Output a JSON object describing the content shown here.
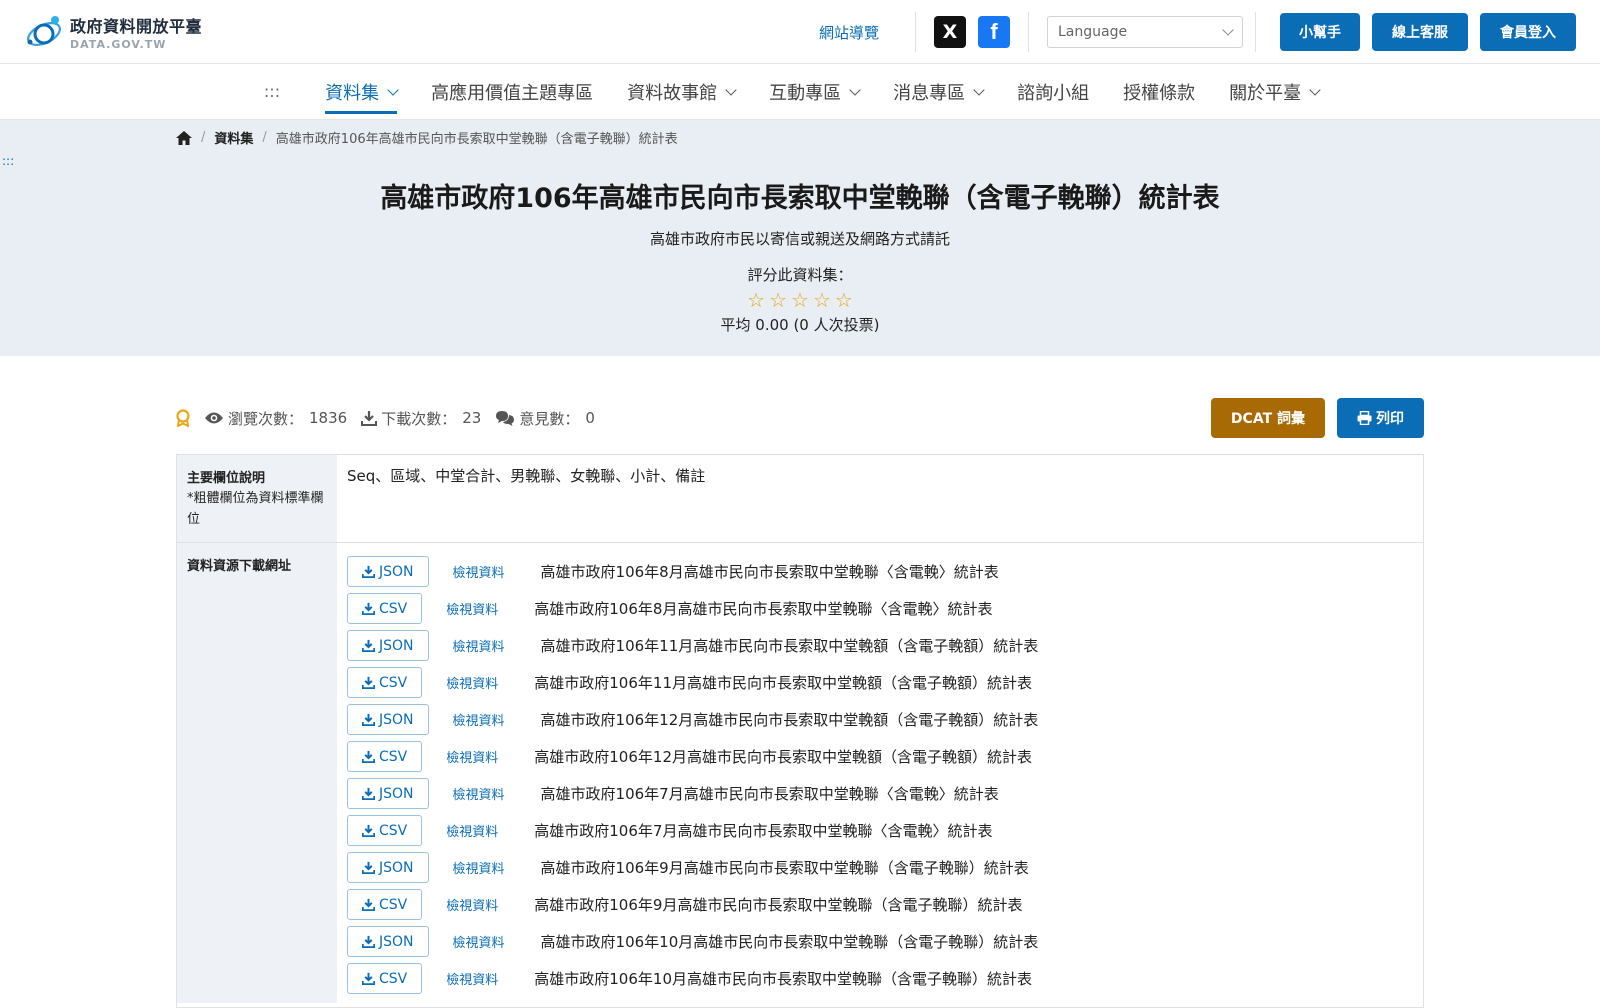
{
  "header": {
    "logo_title": "政府資料開放平臺",
    "logo_sub": "DATA.GOV.TW",
    "sitemap": "網站導覽",
    "social_x": "X",
    "social_fb": "f",
    "language_placeholder": "Language",
    "helper_btn": "小幫手",
    "service_btn": "線上客服",
    "login_btn": "會員登入"
  },
  "nav": {
    "access": ":::",
    "items": [
      {
        "label": "資料集"
      },
      {
        "label": "高應用價值主題專區"
      },
      {
        "label": "資料故事館"
      },
      {
        "label": "互動專區"
      },
      {
        "label": "消息專區"
      },
      {
        "label": "諮詢小組"
      },
      {
        "label": "授權條款"
      },
      {
        "label": "關於平臺"
      }
    ]
  },
  "breadcrumb": {
    "dataset": "資料集",
    "current": "高雄市政府106年高雄市民向市長索取中堂輓聯（含電子輓聯）統計表"
  },
  "hero": {
    "access": ":::",
    "title": "高雄市政府106年高雄市民向市長索取中堂輓聯（含電子輓聯）統計表",
    "desc": "高雄市政府市民以寄信或親送及網路方式請託",
    "rate_label": "評分此資料集：",
    "rating": 0,
    "avg": "平均 0.00 (0 人次投票)"
  },
  "stats": {
    "views_label": "瀏覽次數：",
    "views": "1836",
    "downloads_label": "下載次數：",
    "downloads": "23",
    "comments_label": "意見數：",
    "comments": "0",
    "dcat_btn": "DCAT 詞彙",
    "print_btn": "列印"
  },
  "table": {
    "fields_header": "主要欄位說明",
    "fields_sub": "*粗體欄位為資料標準欄位",
    "fields_value": "Seq、區域、中堂合計、男輓聯、女輓聯、小計、備註",
    "resources_header": "資料資源下載網址",
    "view_label": "檢視資料",
    "resources": [
      {
        "format": "JSON",
        "name": "高雄市政府106年8月高雄市民向市長索取中堂輓聯〈含電輓〉統計表"
      },
      {
        "format": "CSV",
        "name": "高雄市政府106年8月高雄市民向市長索取中堂輓聯〈含電輓〉統計表"
      },
      {
        "format": "JSON",
        "name": "高雄市政府106年11月高雄市民向市長索取中堂輓額（含電子輓額）統計表"
      },
      {
        "format": "CSV",
        "name": "高雄市政府106年11月高雄市民向市長索取中堂輓額（含電子輓額）統計表"
      },
      {
        "format": "JSON",
        "name": "高雄市政府106年12月高雄市民向市長索取中堂輓額（含電子輓額）統計表"
      },
      {
        "format": "CSV",
        "name": "高雄市政府106年12月高雄市民向市長索取中堂輓額（含電子輓額）統計表"
      },
      {
        "format": "JSON",
        "name": "高雄市政府106年7月高雄市民向市長索取中堂輓聯〈含電輓〉統計表"
      },
      {
        "format": "CSV",
        "name": "高雄市政府106年7月高雄市民向市長索取中堂輓聯〈含電輓〉統計表"
      },
      {
        "format": "JSON",
        "name": "高雄市政府106年9月高雄市民向市長索取中堂輓聯（含電子輓聯）統計表"
      },
      {
        "format": "CSV",
        "name": "高雄市政府106年9月高雄市民向市長索取中堂輓聯（含電子輓聯）統計表"
      },
      {
        "format": "JSON",
        "name": "高雄市政府106年10月高雄市民向市長索取中堂輓聯（含電子輓聯）統計表"
      },
      {
        "format": "CSV",
        "name": "高雄市政府106年10月高雄市民向市長索取中堂輓聯（含電子輓聯）統計表"
      }
    ]
  }
}
